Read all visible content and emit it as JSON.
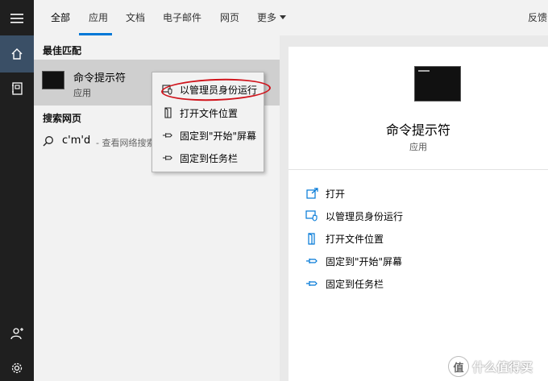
{
  "tabs": [
    {
      "label": "全部",
      "selected": true
    },
    {
      "label": "应用"
    },
    {
      "label": "文档"
    },
    {
      "label": "电子邮件"
    },
    {
      "label": "网页"
    },
    {
      "label": "更多"
    }
  ],
  "feedback_label": "反馈",
  "results": {
    "best_match_title": "最佳匹配",
    "best_match": {
      "name": "命令提示符",
      "type": "应用"
    },
    "web_title": "搜索网页",
    "web_query": "c'm'd",
    "web_hint": "- 查看网络搜索"
  },
  "context_menu": {
    "items": [
      {
        "label": "以管理员身份运行",
        "icon": "shield-admin-icon",
        "highlighted": true
      },
      {
        "label": "打开文件位置",
        "icon": "file-location-icon"
      },
      {
        "label": "固定到\"开始\"屏幕",
        "icon": "pin-icon"
      },
      {
        "label": "固定到任务栏",
        "icon": "pin-icon"
      }
    ]
  },
  "detail": {
    "name": "命令提示符",
    "type": "应用",
    "actions": [
      {
        "label": "打开",
        "icon": "open-icon"
      },
      {
        "label": "以管理员身份运行",
        "icon": "shield-admin-icon"
      },
      {
        "label": "打开文件位置",
        "icon": "file-location-icon"
      },
      {
        "label": "固定到\"开始\"屏幕",
        "icon": "pin-icon"
      },
      {
        "label": "固定到任务栏",
        "icon": "pin-icon"
      }
    ]
  },
  "watermark": {
    "badge": "值",
    "text": "什么值得买"
  },
  "colors": {
    "accent": "#0078d7",
    "rail": "#1f1f1f",
    "highlight": "#cfcfcf",
    "annotation": "#d0141c"
  }
}
